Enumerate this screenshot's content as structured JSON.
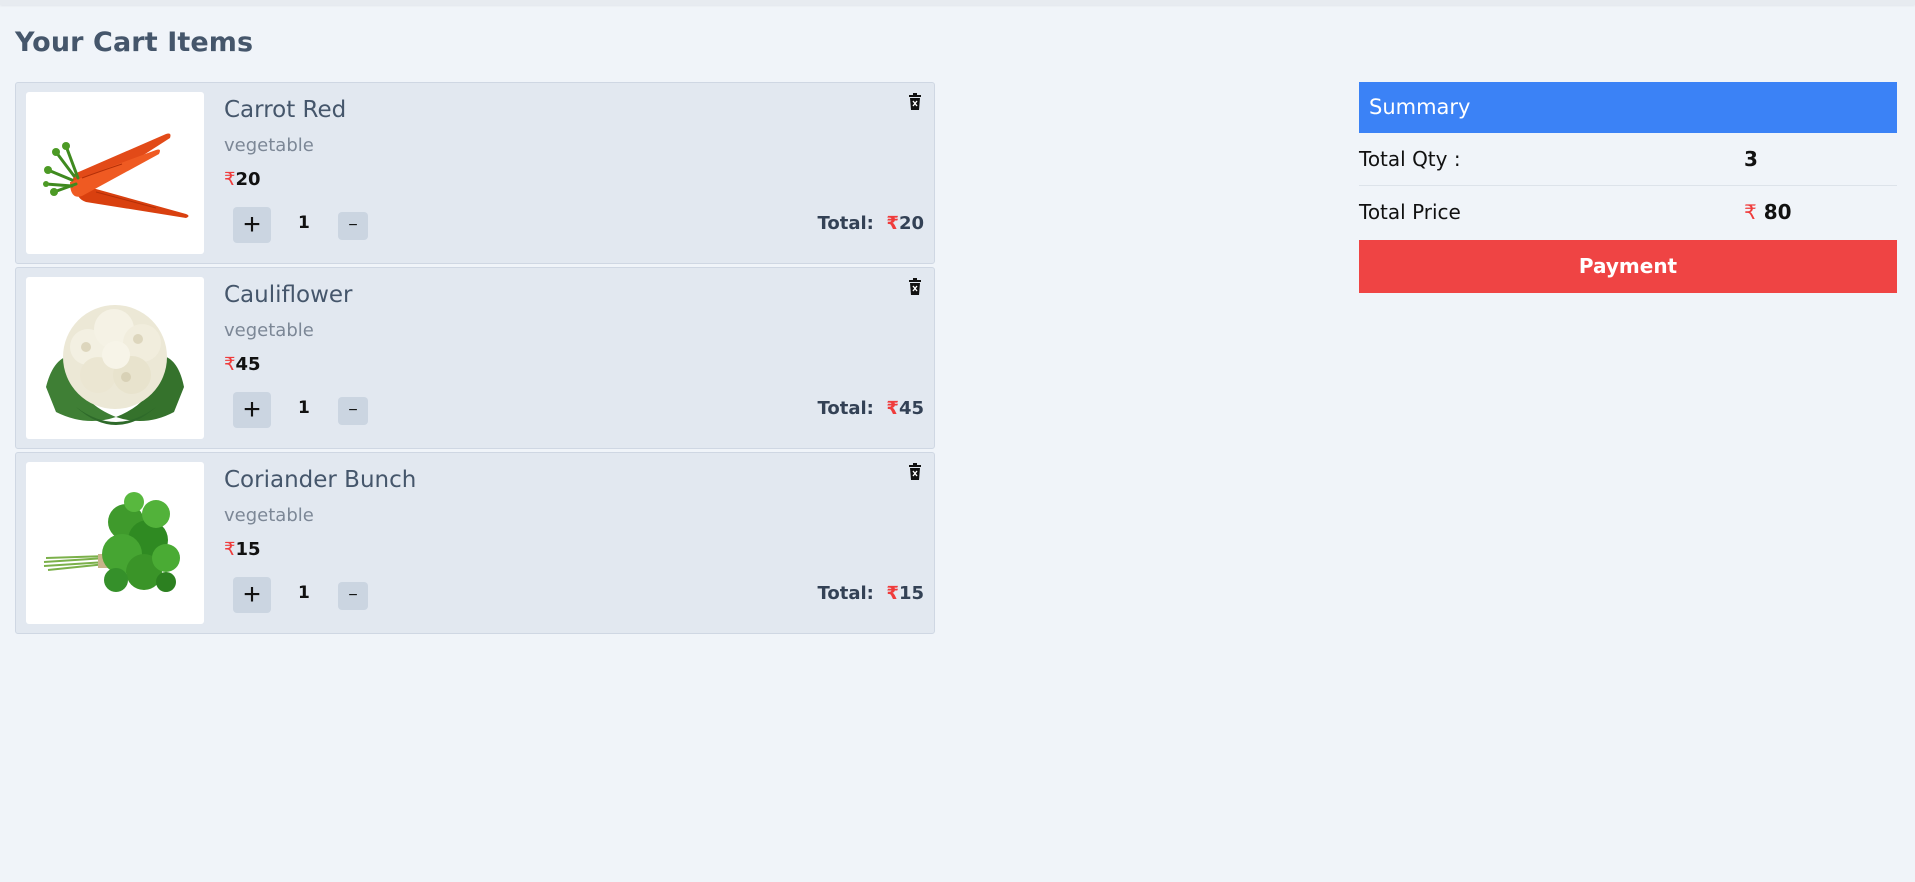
{
  "page": {
    "title": "Your Cart Items"
  },
  "currency_symbol": "₹",
  "colors": {
    "background": "#f0f4f9",
    "card": "#e2e8f0",
    "accent_blue": "#3b82f6",
    "payment_red": "#ef4444",
    "rupee_red": "#ef3b3b"
  },
  "cart": {
    "items": [
      {
        "name": "Carrot Red",
        "category": "vegetable",
        "price": "20",
        "quantity": "1",
        "plus_label": "+",
        "minus_label": "−",
        "total_label": "Total:",
        "total": "20",
        "image_icon": "carrot-image"
      },
      {
        "name": "Cauliflower",
        "category": "vegetable",
        "price": "45",
        "quantity": "1",
        "plus_label": "+",
        "minus_label": "−",
        "total_label": "Total:",
        "total": "45",
        "image_icon": "cauliflower-image"
      },
      {
        "name": "Coriander Bunch",
        "category": "vegetable",
        "price": "15",
        "quantity": "1",
        "plus_label": "+",
        "minus_label": "−",
        "total_label": "Total:",
        "total": "15",
        "image_icon": "coriander-image"
      }
    ]
  },
  "summary": {
    "header": "Summary",
    "total_qty_label": "Total Qty :",
    "total_qty": "3",
    "total_price_label": "Total Price",
    "total_price": "80",
    "payment_label": "Payment"
  }
}
